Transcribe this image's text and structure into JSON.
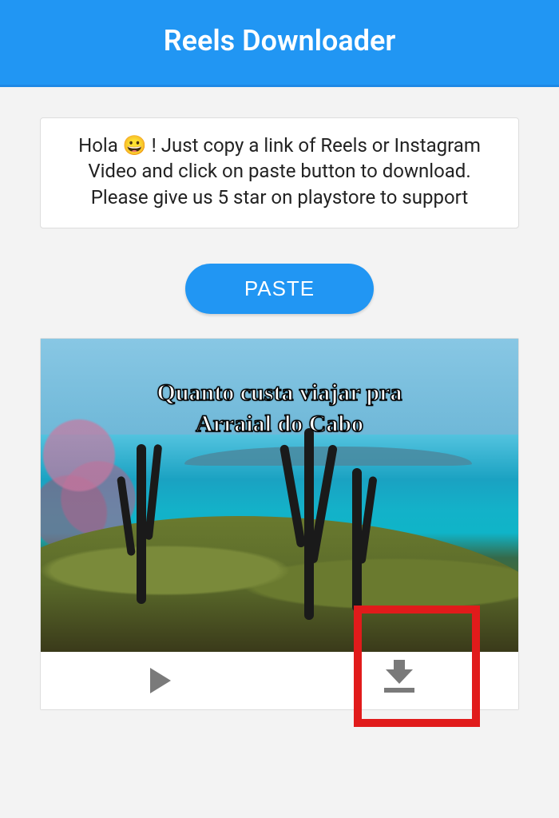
{
  "header": {
    "title": "Reels Downloader"
  },
  "info": {
    "message": "Hola 😀 ! Just copy a link of Reels or Instagram Video and click on paste button to download. Please give us 5 star on playstore to support"
  },
  "buttons": {
    "paste": "PASTE"
  },
  "video": {
    "caption": "Quanto custa viajar pra\nArraial do Cabo",
    "icons": {
      "play": "play-icon",
      "download": "download-icon"
    }
  }
}
